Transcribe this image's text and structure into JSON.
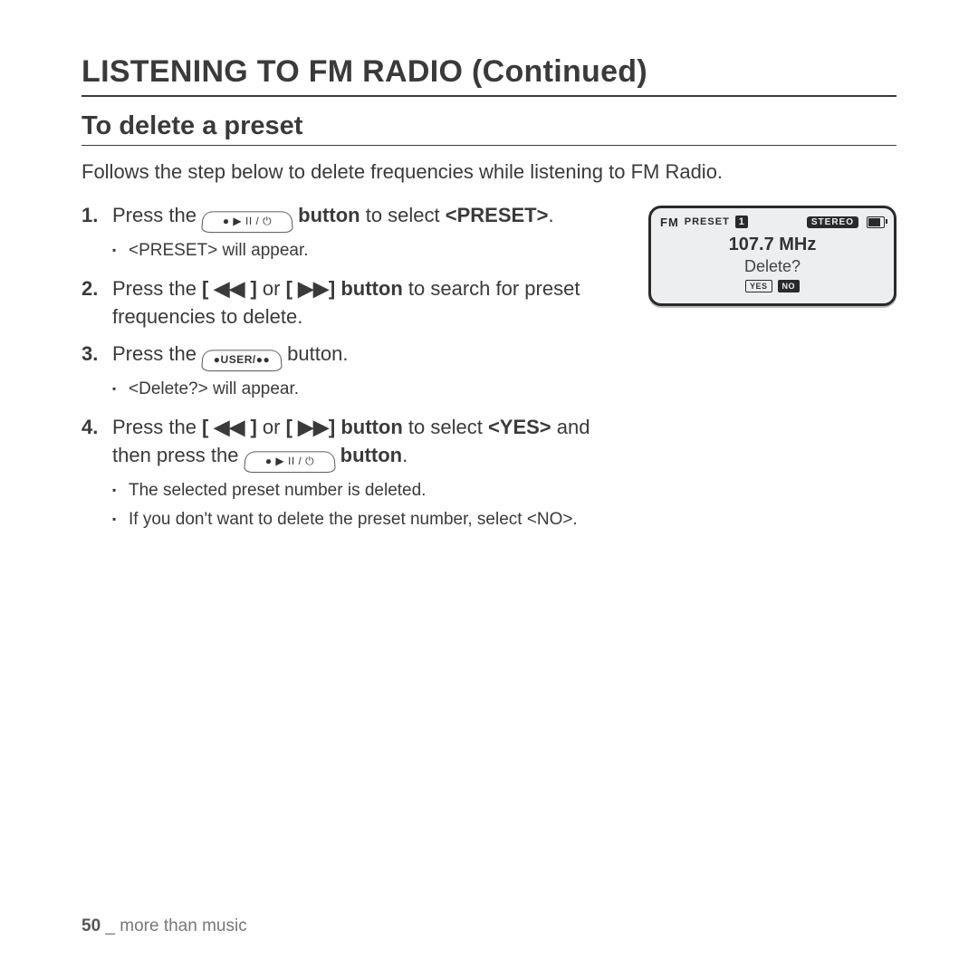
{
  "title": "LISTENING TO FM RADIO (Continued)",
  "section": "To delete a preset",
  "intro": "Follows the step below to delete frequencies while listening to FM Radio.",
  "steps": {
    "s1": {
      "a": "Press the ",
      "b": " button",
      "c": " to select ",
      "d": "<PRESET>",
      "e": ".",
      "sub1": "<PRESET> will appear."
    },
    "s2": {
      "a": "Press the ",
      "b": "[ ",
      "prev": "◀◀",
      "c": " ]",
      "d": " or ",
      "e": "[ ",
      "next": "▶▶",
      "f": "] button",
      "g": " to search for preset frequencies to delete."
    },
    "s3": {
      "a": "Press the ",
      "b": " button.",
      "sub1": "<Delete?> will appear."
    },
    "s4": {
      "a": "Press the ",
      "b": "[ ",
      "prev": "◀◀",
      "c": " ]",
      "d": " or ",
      "e": "[ ",
      "next": "▶▶",
      "f": "] button",
      "g": " to select ",
      "h": "<YES>",
      "i": " and then press the ",
      "j": " button",
      "k": ".",
      "sub1": "The selected preset number is deleted.",
      "sub2": "If you don't want to delete the preset number, select <NO>."
    }
  },
  "buttons": {
    "play": "● ▶ II / ⏻",
    "user": "●USER/●●"
  },
  "device": {
    "fm": "FM",
    "preset": "PRESET",
    "num": "1",
    "stereo": "STEREO",
    "freq": "107.7 MHz",
    "prompt": "Delete?",
    "yes": "YES",
    "no": "NO"
  },
  "footer": {
    "page": "50",
    "sep": " _ ",
    "label": "more than music"
  }
}
